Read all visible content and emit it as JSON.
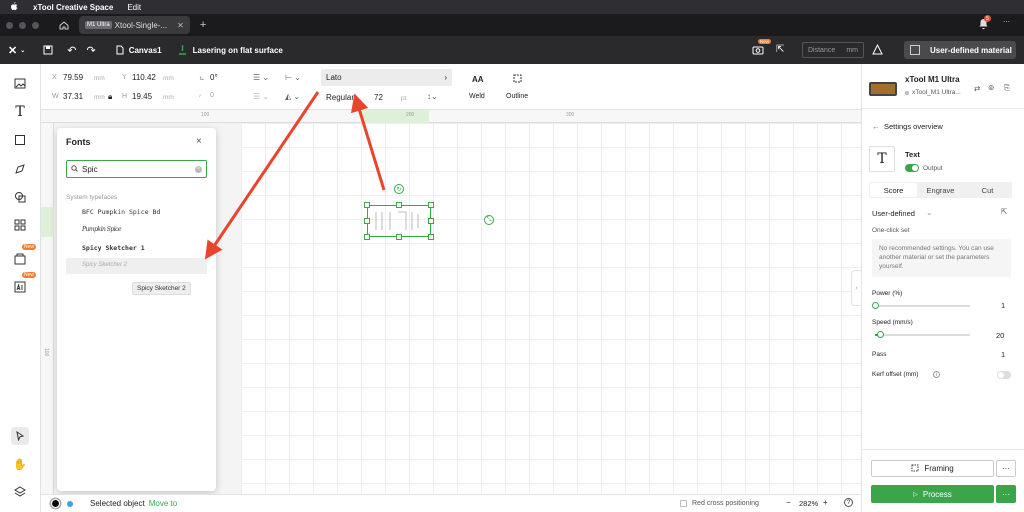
{
  "menubar": {
    "app": "xTool Creative Space",
    "edit": "Edit"
  },
  "tabs": {
    "chip": "M1 Ultra",
    "title": "Xtool-Single-...",
    "add": "+",
    "notif_count": "5"
  },
  "toolbar": {
    "canvas": "Canvas1",
    "mode": "Lasering on flat surface",
    "distance_placeholder": "Distance",
    "distance_unit": "mm",
    "material": "User-defined material",
    "new_badge": "New"
  },
  "props": {
    "x_label": "X",
    "x": "79.59",
    "y_label": "Y",
    "y": "110.42",
    "w_label": "W",
    "w": "37.31",
    "h_label": "H",
    "h": "19.45",
    "unit": "mm",
    "rotation": "0°",
    "radius": "0",
    "font": "Lato",
    "style": "Regular",
    "size": "72",
    "size_unit": "pt",
    "weld": "Weld",
    "outline": "Outline"
  },
  "ruler": {
    "r100": "100",
    "r200": "200",
    "r300": "300",
    "v100": "100"
  },
  "fonts": {
    "title": "Fonts",
    "search_value": "Spic",
    "section": "System typefaces",
    "items": [
      "BFC Pumpkin Spice Bd",
      "Pumpkin Spice",
      "Spicy Sketcher 1",
      "Spicy Sketcher 2"
    ],
    "tooltip": "Spicy Sketcher 2"
  },
  "leftrail": {
    "new1": "New",
    "new2": "New"
  },
  "status": {
    "selected": "Selected object",
    "move_to": "Move to",
    "red_cross": "Red cross positioning",
    "zoom": "282%",
    "minus": "−",
    "plus": "+",
    "help": "?"
  },
  "right": {
    "device": "xTool M1 Ultra",
    "device_sub": "xTool_M1 Ultra...",
    "settings": "Settings overview",
    "text": "Text",
    "output": "Output",
    "tabs": [
      "Score",
      "Engrave",
      "Cut"
    ],
    "preset": "User-defined",
    "one_click": "One-click set",
    "note": "No recommended settings. You can use another material or set the parameters yourself.",
    "power_label": "Power (%)",
    "power": "1",
    "speed_label": "Speed (mm/s)",
    "speed": "20",
    "pass_label": "Pass",
    "pass": "1",
    "kerf_label": "Kerf offset (mm)",
    "framing": "Framing",
    "process": "Process",
    "more": "···"
  },
  "colors": {
    "accent": "#3aa64a",
    "arrow": "#e8452c"
  }
}
